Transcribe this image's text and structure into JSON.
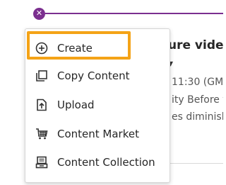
{
  "background": {
    "title_fragment": "ure video",
    "arrow_fragment": "▾",
    "time_fragment": "11:30 (GMT",
    "line1_fragment": "ity Before t",
    "line2_fragment": "es diminish"
  },
  "menu": {
    "items": [
      {
        "label": "Create",
        "icon": "plus-circle-icon"
      },
      {
        "label": "Copy Content",
        "icon": "copy-icon"
      },
      {
        "label": "Upload",
        "icon": "upload-icon"
      },
      {
        "label": "Content Market",
        "icon": "cart-icon"
      },
      {
        "label": "Content Collection",
        "icon": "collection-icon"
      }
    ],
    "highlighted_item": "Create"
  },
  "colors": {
    "accent_purple": "#7b2f8f",
    "highlight_orange": "#f4a317"
  }
}
